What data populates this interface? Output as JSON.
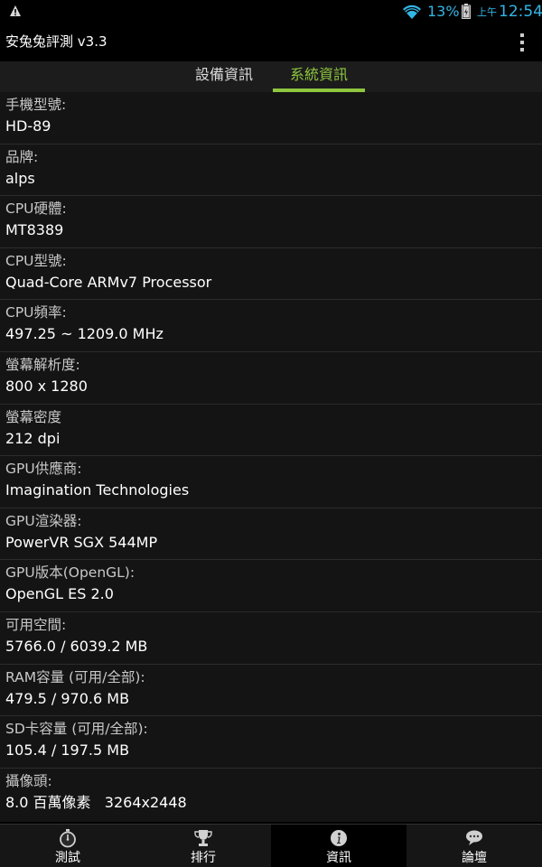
{
  "status_bar": {
    "battery_pct": "13%",
    "ampm": "上午",
    "time": "12:54",
    "icons": [
      "warning-icon",
      "wifi-icon",
      "battery-icon"
    ],
    "accent_color": "#33b5e5"
  },
  "action_bar": {
    "title": "安兔兔評測 v3.3",
    "menu_icon": "overflow-menu-icon"
  },
  "tabs": {
    "items": [
      {
        "label": "設備資訊",
        "selected": false
      },
      {
        "label": "系統資訊",
        "selected": true
      }
    ],
    "selected_color": "#8ec63f"
  },
  "info": {
    "items": [
      {
        "label": "手機型號:",
        "value": "HD-89"
      },
      {
        "label": "品牌:",
        "value": "alps"
      },
      {
        "label": "CPU硬體:",
        "value": "MT8389"
      },
      {
        "label": "CPU型號:",
        "value": "Quad-Core ARMv7 Processor"
      },
      {
        "label": "CPU頻率:",
        "value": "497.25 ~ 1209.0 MHz"
      },
      {
        "label": "螢幕解析度:",
        "value": "800 x 1280"
      },
      {
        "label": "螢幕密度",
        "value": "212 dpi"
      },
      {
        "label": "GPU供應商:",
        "value": "Imagination Technologies"
      },
      {
        "label": "GPU渲染器:",
        "value": "PowerVR SGX 544MP"
      },
      {
        "label": "GPU版本(OpenGL):",
        "value": "OpenGL ES 2.0"
      },
      {
        "label": "可用空間:",
        "value": "5766.0 / 6039.2 MB"
      },
      {
        "label": "RAM容量 (可用/全部):",
        "value": "479.5 / 970.6 MB"
      },
      {
        "label": "SD卡容量 (可用/全部):",
        "value": "105.4 / 197.5 MB"
      },
      {
        "label": "攝像頭:",
        "value": "8.0 百萬像素   3264x2448"
      }
    ]
  },
  "bottom_nav": {
    "items": [
      {
        "label": "測試",
        "icon": "stopwatch-icon",
        "active": false
      },
      {
        "label": "排行",
        "icon": "trophy-icon",
        "active": false
      },
      {
        "label": "資訊",
        "icon": "info-icon",
        "active": true
      },
      {
        "label": "論壇",
        "icon": "chat-bubble-icon",
        "active": false
      }
    ]
  }
}
